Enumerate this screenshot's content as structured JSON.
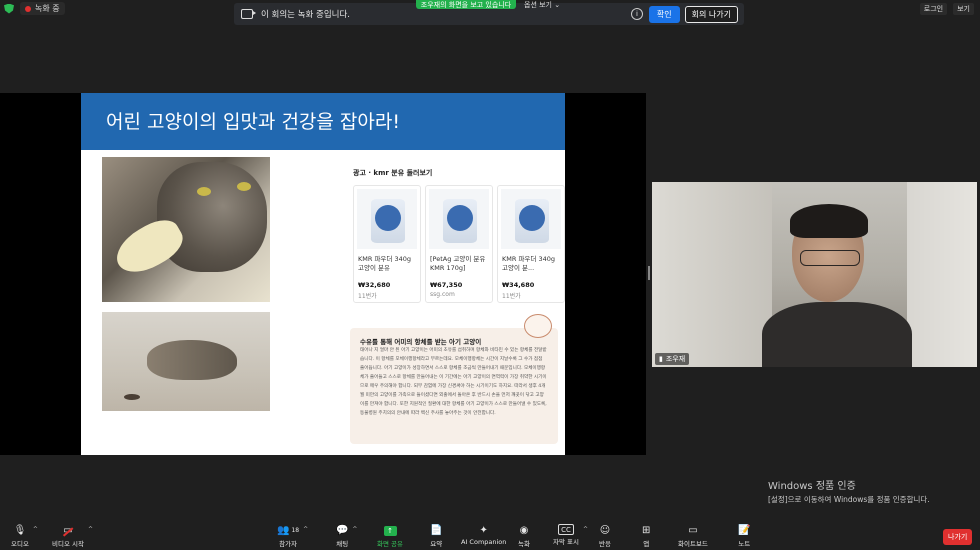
{
  "top": {
    "recording_label": "녹화 중",
    "share_banner": "조우재의 화면을 보고 있습니다",
    "view_options": "옵션 보기",
    "notice_message": "이 회의는 녹화 중입니다.",
    "confirm_button": "확인",
    "leave_meeting_button": "회의 나가기",
    "right_items": [
      "로그인",
      "보기"
    ]
  },
  "slide": {
    "title": "어린 고양이의 입맛과 건강을 잡아라!",
    "ad_label": "광고 · kmr 분유 둘러보기",
    "products": [
      {
        "name": "KMR 파우더 340g 고양이 분유",
        "price": "₩32,680",
        "seller": "11번가"
      },
      {
        "name": "[PetAg 고양이 분유 KMR 170g]",
        "price": "₩67,350",
        "seller": "ssg.com"
      },
      {
        "name": "KMR 파우더 340g 고양이 분...",
        "price": "₩34,680",
        "seller": "11번가"
      }
    ],
    "info_title": "수유를 통해 어미의 항체를 받는 아기 고양이",
    "info_body": "태어나 지 얼마 안 된 아기 고양이는 어미의 초유를 섭취하며 항체와 비타민 수 있는 항체를 전달받습니다. 이 항체를 모체이행항체라고 부르는데요. 모체이행항체는 시간이 지날수록 그 수가 점점 줄어듭니다. 아기 고양이가 성장하면서 스스로 항체를 조금씩 만들어내기 때문입니다. 모체이행항체가 줄어들고 스스로 항체를 만들어내는 이 기간에는 아기 고양이의 면역력이 가장 취약한 시기이므로 매우 주의해야 합니다. 되부 감염에 가장 신경써야 하는 시기이기도 하지요. 따라서 생후 4개월 미만의 고양이를 가족으로 들이셨다면 외출에서 돌아온 후 반드시 손을 먼저 깨끗이 닦고 고양이를 만져야 합니다. 또한 지원적인 질환에 대한 항체를 아기 고양이가 스스로 만들어낼 수 있도록, 동물병원 주치의의 안내에 따라 백신 주사를 놓아주는 것이 안전합니다."
  },
  "participant": {
    "name": "조우재"
  },
  "windows_activation": {
    "title": "Windows 정품 인증",
    "subtitle": "[설정]으로 이동하여 Windows를 정품 인증합니다."
  },
  "toolbar": {
    "audio": "오디오",
    "video": "비디오 시작",
    "participants": "참가자",
    "participants_count": "18",
    "chat": "채팅",
    "share": "화면 공유",
    "summary": "요약",
    "ai": "AI Companion",
    "record": "녹화",
    "captions": "자막 표시",
    "reactions": "반응",
    "apps": "앱",
    "whiteboard": "화이트보드",
    "notes": "노트",
    "leave": "나가기"
  }
}
